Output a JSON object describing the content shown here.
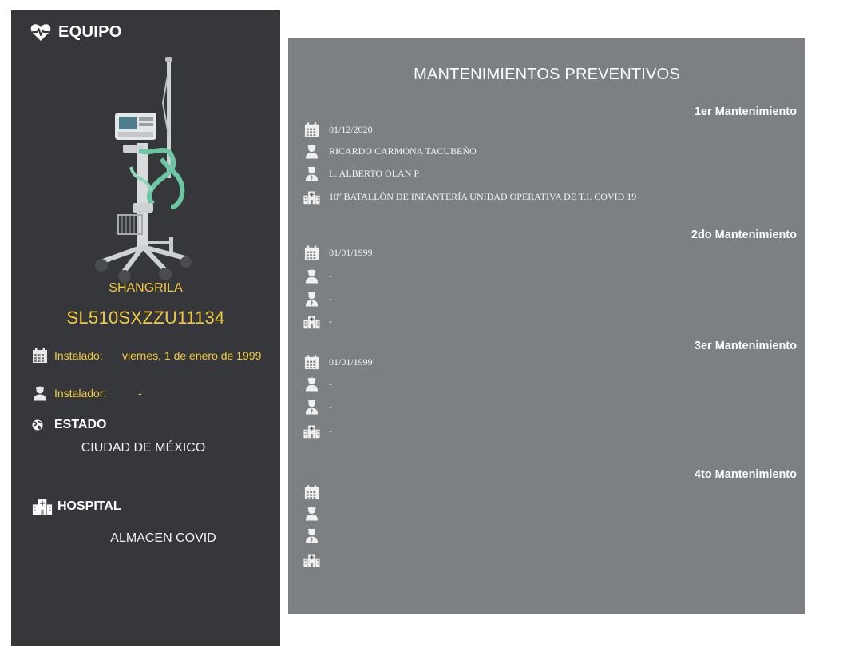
{
  "equipo": {
    "title": "EQUIPO",
    "brand": "SHANGRILA",
    "serial": "SL510SXZZU11134",
    "installed_label": "Instalado:",
    "installed_value": "viernes, 1 de enero de 1999",
    "installer_label": "Instalador:",
    "installer_value": "-",
    "estado_label": "ESTADO",
    "estado_value": "CIUDAD DE MÉXICO",
    "hospital_label": "HOSPITAL",
    "hospital_value": "ALMACEN COVID"
  },
  "maintenance": {
    "title": "MANTENIMIENTOS PREVENTIVOS",
    "items": [
      {
        "title": "1er Mantenimiento",
        "date": "01/12/2020",
        "technician": "RICARDO CARMONA TACUBEÑO",
        "supervisor": "L. ALBERTO OLAN P",
        "location_num": "10",
        "location_ord": "o",
        "location_text": " BATALLÓN DE INFANTERÍA UNIDAD OPERATIVA DE T.I. COVID 19"
      },
      {
        "title": "2do Mantenimiento",
        "date": "01/01/1999",
        "technician": "-",
        "supervisor": "-",
        "location": "-"
      },
      {
        "title": "3er Mantenimiento",
        "date": "01/01/1999",
        "technician": "-",
        "supervisor": "-",
        "location": "-"
      },
      {
        "title": "4to Mantenimiento",
        "date": "",
        "technician": "",
        "supervisor": "",
        "location": ""
      }
    ]
  },
  "icons": {
    "header": "heartbeat-icon",
    "date": "calendar-icon",
    "technician": "user-icon",
    "supervisor": "user-tie-icon",
    "location": "hospital-icon",
    "estado": "globe-icon"
  },
  "colors": {
    "left_panel": "#35373a",
    "right_panel": "#7d8083",
    "accent": "#f3c93f"
  }
}
